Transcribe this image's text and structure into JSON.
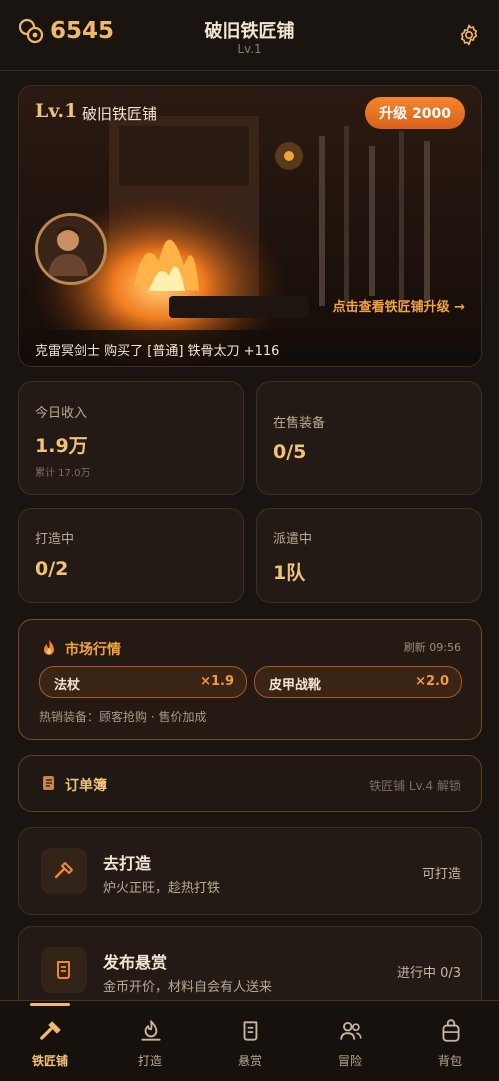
{
  "header": {
    "coin_value": "6545",
    "title": "破旧铁匠铺",
    "subtitle": "Lv.1",
    "icons": [
      "coin-icon",
      "gear-icon"
    ]
  },
  "hero": {
    "level": "Lv.1",
    "name": "破旧铁匠铺",
    "upgrade_label": "升级 2000",
    "link_label": "点击查看铁匠铺升级 →",
    "ticker": "克雷冥剑士 购买了 [普通] 铁骨太刀 +116"
  },
  "stats": [
    {
      "label": "今日收入",
      "value": "1.9万",
      "foot": "累计 17.0万"
    },
    {
      "label": "在售装备",
      "value": "0/5"
    },
    {
      "label": "打造中",
      "value": "0/2"
    },
    {
      "label": "派遣中",
      "value": "1队"
    }
  ],
  "market": {
    "title": "市场行情",
    "refresh": "刷新 09:56",
    "chips": [
      {
        "name": "法杖",
        "mult": "×1.9"
      },
      {
        "name": "皮甲战靴",
        "mult": "×2.0"
      }
    ],
    "note": "热销装备：顾客抢购 · 售价加成"
  },
  "order_book": {
    "title": "订单簿",
    "lock_text": "铁匠铺 Lv.4 解锁"
  },
  "actions": [
    {
      "title": "去打造",
      "desc": "炉火正旺，趁热打铁",
      "status": "可打造",
      "icon": "hammer-icon"
    },
    {
      "title": "发布悬赏",
      "desc": "金币开价，材料自会有人送来",
      "status": "进行中 0/3",
      "icon": "scroll-icon"
    }
  ],
  "tabs": [
    {
      "label": "铁匠铺",
      "icon": "hammer-icon",
      "active": true
    },
    {
      "label": "打造",
      "icon": "fire-icon"
    },
    {
      "label": "悬赏",
      "icon": "scroll-icon"
    },
    {
      "label": "冒险",
      "icon": "people-icon"
    },
    {
      "label": "背包",
      "icon": "backpack-icon"
    }
  ],
  "colors": {
    "accent": "#f0b86a",
    "orange": "#f3862d",
    "background": "#1a1411"
  }
}
